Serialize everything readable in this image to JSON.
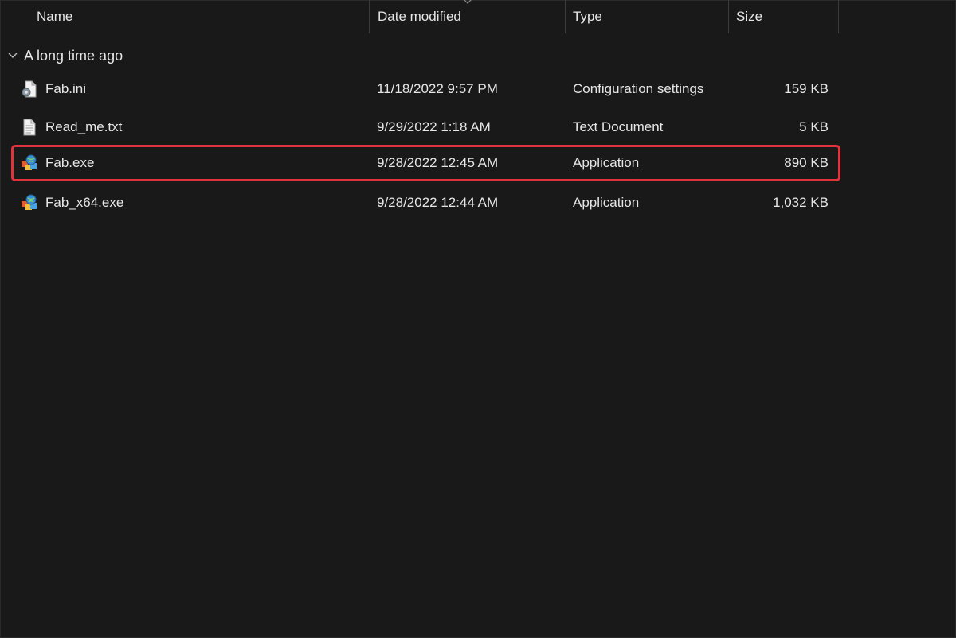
{
  "columns": {
    "name": "Name",
    "date_modified": "Date modified",
    "type": "Type",
    "size": "Size"
  },
  "sort": {
    "column": "date_modified",
    "icon": "sort-caret-icon"
  },
  "group": {
    "label": "A long time ago",
    "icon": "chevron-down-icon"
  },
  "files": [
    {
      "name": "Fab.ini",
      "date": "11/18/2022 9:57 PM",
      "type": "Configuration settings",
      "size": "159 KB",
      "icon": "settings-file-icon",
      "highlighted": false
    },
    {
      "name": "Read_me.txt",
      "date": "9/29/2022 1:18 AM",
      "type": "Text Document",
      "size": "5 KB",
      "icon": "text-file-icon",
      "highlighted": false
    },
    {
      "name": "Fab.exe",
      "date": "9/28/2022 12:45 AM",
      "type": "Application",
      "size": "890 KB",
      "icon": "application-icon",
      "highlighted": true
    },
    {
      "name": "Fab_x64.exe",
      "date": "9/28/2022 12:44 AM",
      "type": "Application",
      "size": "1,032 KB",
      "icon": "application-icon",
      "highlighted": false
    }
  ],
  "colors": {
    "background": "#191919",
    "text": "#e6e6e6",
    "highlight_border": "#e0333d",
    "column_separator": "#3a3a3a"
  }
}
